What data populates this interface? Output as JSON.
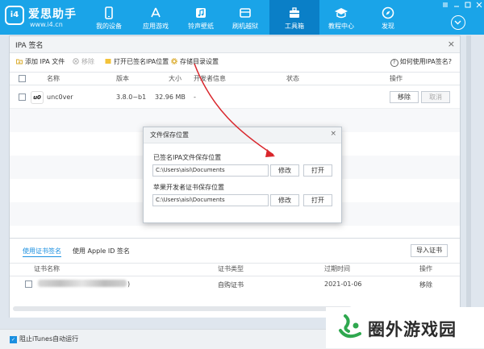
{
  "app": {
    "logo_glyph": "i4",
    "name": "爱思助手",
    "url": "www.i4.cn"
  },
  "nav": [
    {
      "label": "我的设备",
      "icon": "phone-icon"
    },
    {
      "label": "应用游戏",
      "icon": "appstore-icon"
    },
    {
      "label": "铃声壁纸",
      "icon": "music-icon"
    },
    {
      "label": "刷机越狱",
      "icon": "box-icon"
    },
    {
      "label": "工具箱",
      "icon": "toolbox-icon",
      "active": true
    },
    {
      "label": "教程中心",
      "icon": "graduation-cap-icon"
    },
    {
      "label": "发现",
      "icon": "compass-icon"
    }
  ],
  "panel": {
    "title": "IPA 签名",
    "toolbar": {
      "add": "添加 IPA 文件",
      "remove": "移除",
      "open_signed": "打开已签名IPA位置",
      "storage": "存储目录设置",
      "help": "如何使用IPA签名?"
    },
    "columns": {
      "name": "名称",
      "version": "版本",
      "size": "大小",
      "developer": "开发者信息",
      "status": "状态",
      "actions": "操作"
    },
    "rows": [
      {
        "icon_text": "u0",
        "name": "unc0ver",
        "version": "3.8.0~b1",
        "size": "32.96 MB",
        "developer": "-",
        "status": "",
        "remove": "移除",
        "cancel": "取消"
      }
    ]
  },
  "cert": {
    "tab_cert": "使用证书签名",
    "tab_apple": "使用 Apple ID 签名",
    "import": "导入证书",
    "columns": {
      "name": "证书名称",
      "type": "证书类型",
      "expiry": "过期时间",
      "actions": "操作"
    },
    "rows": [
      {
        "name_suffix": ")",
        "type": "自购证书",
        "expiry": "2021-01-06",
        "action": "移除"
      }
    ]
  },
  "dialog": {
    "title": "文件保存位置",
    "signed_label": "已签名IPA文件保存位置",
    "signed_path": "C:\\Users\\aisi\\Documents",
    "cert_label": "苹果开发者证书保存位置",
    "cert_path": "C:\\Users\\aisi\\Documents",
    "modify": "修改",
    "open": "打开"
  },
  "statusbar": {
    "itunes": "阻止iTunes自动运行"
  },
  "watermark": {
    "text": "圈外游戏园"
  },
  "colors": {
    "accent": "#1aa4e8",
    "active_nav": "#0a7fc7",
    "arrow": "#d9262c",
    "link": "#1a8fe0"
  }
}
